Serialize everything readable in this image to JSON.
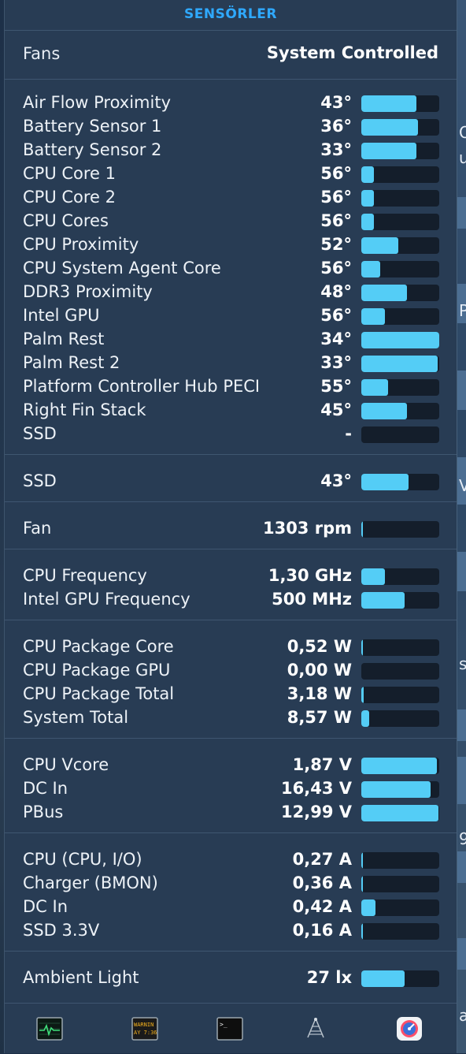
{
  "title": "SENSÖRLER",
  "header": {
    "label": "Fans",
    "value": "System Controlled"
  },
  "sections": [
    {
      "id": "temperatures",
      "rows": [
        {
          "name": "Air Flow Proximity",
          "value": "43°",
          "level": 0.71
        },
        {
          "name": "Battery Sensor 1",
          "value": "36°",
          "level": 0.73
        },
        {
          "name": "Battery Sensor 2",
          "value": "33°",
          "level": 0.71
        },
        {
          "name": "CPU Core 1",
          "value": "56°",
          "level": 0.16
        },
        {
          "name": "CPU Core 2",
          "value": "56°",
          "level": 0.16
        },
        {
          "name": "CPU Cores",
          "value": "56°",
          "level": 0.16
        },
        {
          "name": "CPU Proximity",
          "value": "52°",
          "level": 0.47
        },
        {
          "name": "CPU System Agent Core",
          "value": "56°",
          "level": 0.24
        },
        {
          "name": "DDR3 Proximity",
          "value": "48°",
          "level": 0.59
        },
        {
          "name": "Intel GPU",
          "value": "56°",
          "level": 0.3
        },
        {
          "name": "Palm Rest",
          "value": "34°",
          "level": 1.0
        },
        {
          "name": "Palm Rest 2",
          "value": "33°",
          "level": 0.98
        },
        {
          "name": "Platform Controller Hub PECI",
          "value": "55°",
          "level": 0.34
        },
        {
          "name": "Right Fin Stack",
          "value": "45°",
          "level": 0.59
        },
        {
          "name": "SSD",
          "value": "-",
          "level": 0
        }
      ]
    },
    {
      "id": "ssd",
      "rows": [
        {
          "name": "SSD",
          "value": "43°",
          "level": 0.61
        }
      ]
    },
    {
      "id": "fan",
      "rows": [
        {
          "name": "Fan",
          "value": "1303 rpm",
          "level": 0.02
        }
      ]
    },
    {
      "id": "frequency",
      "rows": [
        {
          "name": "CPU Frequency",
          "value": "1,30 GHz",
          "level": 0.3
        },
        {
          "name": "Intel GPU Frequency",
          "value": "500 MHz",
          "level": 0.56
        }
      ]
    },
    {
      "id": "power",
      "rows": [
        {
          "name": "CPU Package Core",
          "value": "0,52 W",
          "level": 0.02
        },
        {
          "name": "CPU Package GPU",
          "value": "0,00 W",
          "level": 0
        },
        {
          "name": "CPU Package Total",
          "value": "3,18 W",
          "level": 0.03
        },
        {
          "name": "System Total",
          "value": "8,57 W",
          "level": 0.1
        }
      ]
    },
    {
      "id": "voltage",
      "rows": [
        {
          "name": "CPU Vcore",
          "value": "1,87 V",
          "level": 0.97
        },
        {
          "name": "DC In",
          "value": "16,43 V",
          "level": 0.89
        },
        {
          "name": "PBus",
          "value": "12,99 V",
          "level": 0.99
        }
      ]
    },
    {
      "id": "current",
      "rows": [
        {
          "name": "CPU (CPU, I/O)",
          "value": "0,27 A",
          "level": 0.02
        },
        {
          "name": "Charger (BMON)",
          "value": "0,36 A",
          "level": 0.02
        },
        {
          "name": "DC In",
          "value": "0,42 A",
          "level": 0.18
        },
        {
          "name": "SSD 3.3V",
          "value": "0,16 A",
          "level": 0.02
        }
      ]
    },
    {
      "id": "light",
      "rows": [
        {
          "name": "Ambient Light",
          "value": "27 lx",
          "level": 0.56
        }
      ]
    }
  ],
  "toolbar": [
    {
      "icon": "activity-monitor-icon"
    },
    {
      "icon": "console-icon",
      "text_lines": [
        "WARNIN",
        "AY 7:36"
      ]
    },
    {
      "icon": "terminal-icon",
      "text": ">_"
    },
    {
      "icon": "network-utility-icon"
    },
    {
      "icon": "istat-menus-icon"
    }
  ],
  "colors": {
    "title": "#2fa9ff",
    "bar_fill": "#54cdf6",
    "bar_track": "#141e2b",
    "panel": "#283c54"
  }
}
